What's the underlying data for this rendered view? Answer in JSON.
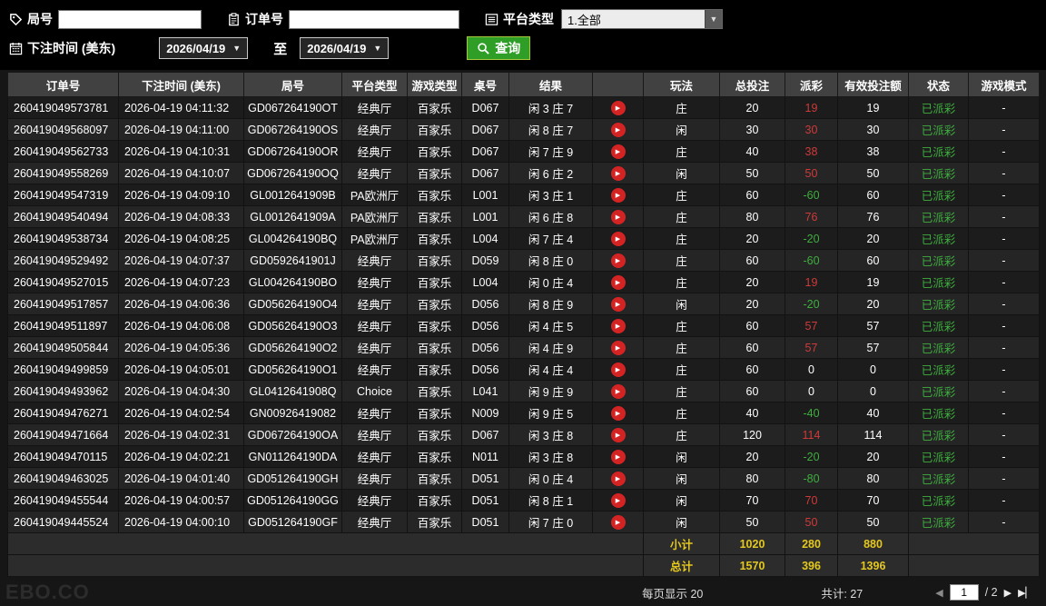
{
  "filters": {
    "game_no_label": "局号",
    "order_no_label": "订单号",
    "platform_type_label": "平台类型",
    "platform_type_value": "1.全部",
    "bet_time_label": "下注时间 (美东)",
    "date_from": "2026/04/19",
    "to_label": "至",
    "date_to": "2026/04/19",
    "search_label": "查询"
  },
  "table": {
    "headers": [
      "订单号",
      "下注时间 (美东)",
      "局号",
      "平台类型",
      "游戏类型",
      "桌号",
      "结果",
      "",
      "玩法",
      "总投注",
      "派彩",
      "有效投注额",
      "状态",
      "游戏模式"
    ],
    "rows": [
      {
        "order": "260419049573781",
        "time": "2026-04-19 04:11:32",
        "game": "GD067264190OT",
        "platform": "经典厅",
        "game_type": "百家乐",
        "table": "D067",
        "result": "闲 3 庄 7",
        "play": "庄",
        "bet": 20,
        "payout": 19,
        "valid": 19,
        "status": "已派彩",
        "mode": "-"
      },
      {
        "order": "260419049568097",
        "time": "2026-04-19 04:11:00",
        "game": "GD067264190OS",
        "platform": "经典厅",
        "game_type": "百家乐",
        "table": "D067",
        "result": "闲 8 庄 7",
        "play": "闲",
        "bet": 30,
        "payout": 30,
        "valid": 30,
        "status": "已派彩",
        "mode": "-"
      },
      {
        "order": "260419049562733",
        "time": "2026-04-19 04:10:31",
        "game": "GD067264190OR",
        "platform": "经典厅",
        "game_type": "百家乐",
        "table": "D067",
        "result": "闲 7 庄 9",
        "play": "庄",
        "bet": 40,
        "payout": 38,
        "valid": 38,
        "status": "已派彩",
        "mode": "-"
      },
      {
        "order": "260419049558269",
        "time": "2026-04-19 04:10:07",
        "game": "GD067264190OQ",
        "platform": "经典厅",
        "game_type": "百家乐",
        "table": "D067",
        "result": "闲 6 庄 2",
        "play": "闲",
        "bet": 50,
        "payout": 50,
        "valid": 50,
        "status": "已派彩",
        "mode": "-"
      },
      {
        "order": "260419049547319",
        "time": "2026-04-19 04:09:10",
        "game": "GL0012641909B",
        "platform": "PA欧洲厅",
        "game_type": "百家乐",
        "table": "L001",
        "result": "闲 3 庄 1",
        "play": "庄",
        "bet": 60,
        "payout": -60,
        "valid": 60,
        "status": "已派彩",
        "mode": "-"
      },
      {
        "order": "260419049540494",
        "time": "2026-04-19 04:08:33",
        "game": "GL0012641909A",
        "platform": "PA欧洲厅",
        "game_type": "百家乐",
        "table": "L001",
        "result": "闲 6 庄 8",
        "play": "庄",
        "bet": 80,
        "payout": 76,
        "valid": 76,
        "status": "已派彩",
        "mode": "-"
      },
      {
        "order": "260419049538734",
        "time": "2026-04-19 04:08:25",
        "game": "GL004264190BQ",
        "platform": "PA欧洲厅",
        "game_type": "百家乐",
        "table": "L004",
        "result": "闲 7 庄 4",
        "play": "庄",
        "bet": 20,
        "payout": -20,
        "valid": 20,
        "status": "已派彩",
        "mode": "-"
      },
      {
        "order": "260419049529492",
        "time": "2026-04-19 04:07:37",
        "game": "GD0592641901J",
        "platform": "经典厅",
        "game_type": "百家乐",
        "table": "D059",
        "result": "闲 8 庄 0",
        "play": "庄",
        "bet": 60,
        "payout": -60,
        "valid": 60,
        "status": "已派彩",
        "mode": "-"
      },
      {
        "order": "260419049527015",
        "time": "2026-04-19 04:07:23",
        "game": "GL004264190BO",
        "platform": "经典厅",
        "game_type": "百家乐",
        "table": "L004",
        "result": "闲 0 庄 4",
        "play": "庄",
        "bet": 20,
        "payout": 19,
        "valid": 19,
        "status": "已派彩",
        "mode": "-"
      },
      {
        "order": "260419049517857",
        "time": "2026-04-19 04:06:36",
        "game": "GD056264190O4",
        "platform": "经典厅",
        "game_type": "百家乐",
        "table": "D056",
        "result": "闲 8 庄 9",
        "play": "闲",
        "bet": 20,
        "payout": -20,
        "valid": 20,
        "status": "已派彩",
        "mode": "-"
      },
      {
        "order": "260419049511897",
        "time": "2026-04-19 04:06:08",
        "game": "GD056264190O3",
        "platform": "经典厅",
        "game_type": "百家乐",
        "table": "D056",
        "result": "闲 4 庄 5",
        "play": "庄",
        "bet": 60,
        "payout": 57,
        "valid": 57,
        "status": "已派彩",
        "mode": "-"
      },
      {
        "order": "260419049505844",
        "time": "2026-04-19 04:05:36",
        "game": "GD056264190O2",
        "platform": "经典厅",
        "game_type": "百家乐",
        "table": "D056",
        "result": "闲 4 庄 9",
        "play": "庄",
        "bet": 60,
        "payout": 57,
        "valid": 57,
        "status": "已派彩",
        "mode": "-"
      },
      {
        "order": "260419049499859",
        "time": "2026-04-19 04:05:01",
        "game": "GD056264190O1",
        "platform": "经典厅",
        "game_type": "百家乐",
        "table": "D056",
        "result": "闲 4 庄 4",
        "play": "庄",
        "bet": 60,
        "payout": 0,
        "valid": 0,
        "status": "已派彩",
        "mode": "-"
      },
      {
        "order": "260419049493962",
        "time": "2026-04-19 04:04:30",
        "game": "GL0412641908Q",
        "platform": "Choice",
        "game_type": "百家乐",
        "table": "L041",
        "result": "闲 9 庄 9",
        "play": "庄",
        "bet": 60,
        "payout": 0,
        "valid": 0,
        "status": "已派彩",
        "mode": "-"
      },
      {
        "order": "260419049476271",
        "time": "2026-04-19 04:02:54",
        "game": "GN00926419082",
        "platform": "经典厅",
        "game_type": "百家乐",
        "table": "N009",
        "result": "闲 9 庄 5",
        "play": "庄",
        "bet": 40,
        "payout": -40,
        "valid": 40,
        "status": "已派彩",
        "mode": "-"
      },
      {
        "order": "260419049471664",
        "time": "2026-04-19 04:02:31",
        "game": "GD067264190OA",
        "platform": "经典厅",
        "game_type": "百家乐",
        "table": "D067",
        "result": "闲 3 庄 8",
        "play": "庄",
        "bet": 120,
        "payout": 114,
        "valid": 114,
        "status": "已派彩",
        "mode": "-"
      },
      {
        "order": "260419049470115",
        "time": "2026-04-19 04:02:21",
        "game": "GN011264190DA",
        "platform": "经典厅",
        "game_type": "百家乐",
        "table": "N011",
        "result": "闲 3 庄 8",
        "play": "闲",
        "bet": 20,
        "payout": -20,
        "valid": 20,
        "status": "已派彩",
        "mode": "-"
      },
      {
        "order": "260419049463025",
        "time": "2026-04-19 04:01:40",
        "game": "GD051264190GH",
        "platform": "经典厅",
        "game_type": "百家乐",
        "table": "D051",
        "result": "闲 0 庄 4",
        "play": "闲",
        "bet": 80,
        "payout": -80,
        "valid": 80,
        "status": "已派彩",
        "mode": "-"
      },
      {
        "order": "260419049455544",
        "time": "2026-04-19 04:00:57",
        "game": "GD051264190GG",
        "platform": "经典厅",
        "game_type": "百家乐",
        "table": "D051",
        "result": "闲 8 庄 1",
        "play": "闲",
        "bet": 70,
        "payout": 70,
        "valid": 70,
        "status": "已派彩",
        "mode": "-"
      },
      {
        "order": "260419049445524",
        "time": "2026-04-19 04:00:10",
        "game": "GD051264190GF",
        "platform": "经典厅",
        "game_type": "百家乐",
        "table": "D051",
        "result": "闲 7 庄 0",
        "play": "闲",
        "bet": 50,
        "payout": 50,
        "valid": 50,
        "status": "已派彩",
        "mode": "-"
      }
    ],
    "subtotal": {
      "label": "小计",
      "bet": "1020",
      "payout": "280",
      "valid": "880"
    },
    "grand_total": {
      "label": "总计",
      "bet": "1570",
      "payout": "396",
      "valid": "1396"
    }
  },
  "footer": {
    "page_size_label": "每页显示",
    "page_size": "20",
    "total_label": "共计: 27",
    "page_value": "1",
    "page_total": "/ 2",
    "prev_icon": "◀",
    "next_icon": "▶",
    "last_icon": "▶▏"
  },
  "watermark": "EBO.CO"
}
